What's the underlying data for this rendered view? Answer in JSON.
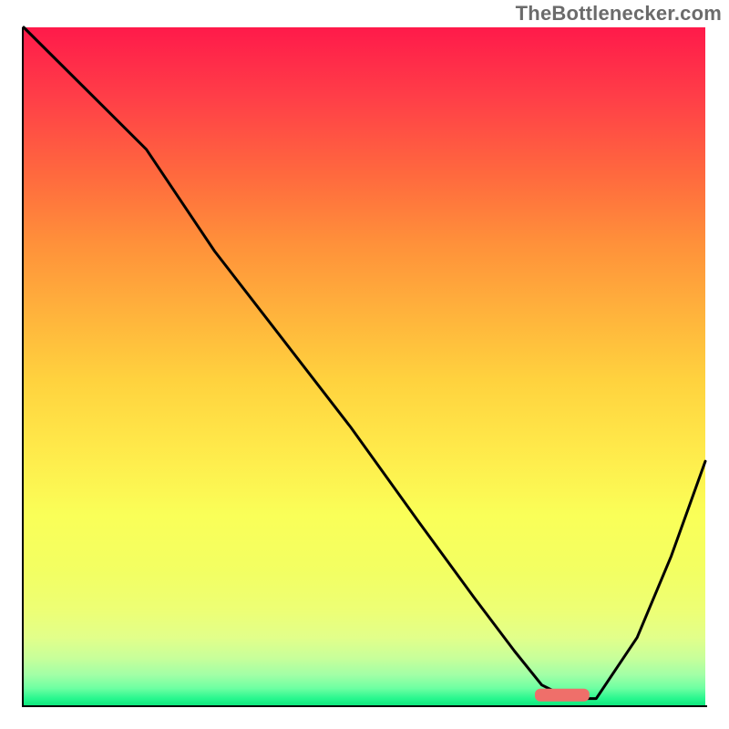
{
  "attribution": "TheBottlenecker.com",
  "chart_data": {
    "type": "line",
    "title": "",
    "xlabel": "",
    "ylabel": "",
    "xlim": [
      0,
      100
    ],
    "ylim": [
      0,
      100
    ],
    "grid": false,
    "legend": false,
    "series": [
      {
        "name": "curve",
        "x": [
          0,
          8,
          18,
          28,
          38,
          48,
          58,
          66,
          72,
          76,
          80,
          84,
          90,
          95,
          100
        ],
        "y": [
          100,
          92,
          82,
          67,
          54,
          41,
          27,
          16,
          8,
          3,
          1,
          1,
          10,
          22,
          36
        ]
      }
    ],
    "marker": {
      "name": "optimum-marker",
      "x_center": 79,
      "y": 1.5,
      "width_pct": 8,
      "color": "#ef6f6a"
    },
    "gradient_stops": [
      {
        "pos": 0,
        "color": "#ff1a4a"
      },
      {
        "pos": 0.25,
        "color": "#ff8a3a"
      },
      {
        "pos": 0.55,
        "color": "#ffe94a"
      },
      {
        "pos": 0.8,
        "color": "#f3ff62"
      },
      {
        "pos": 0.95,
        "color": "#a2ffa6"
      },
      {
        "pos": 1.0,
        "color": "#0ee77d"
      }
    ]
  }
}
